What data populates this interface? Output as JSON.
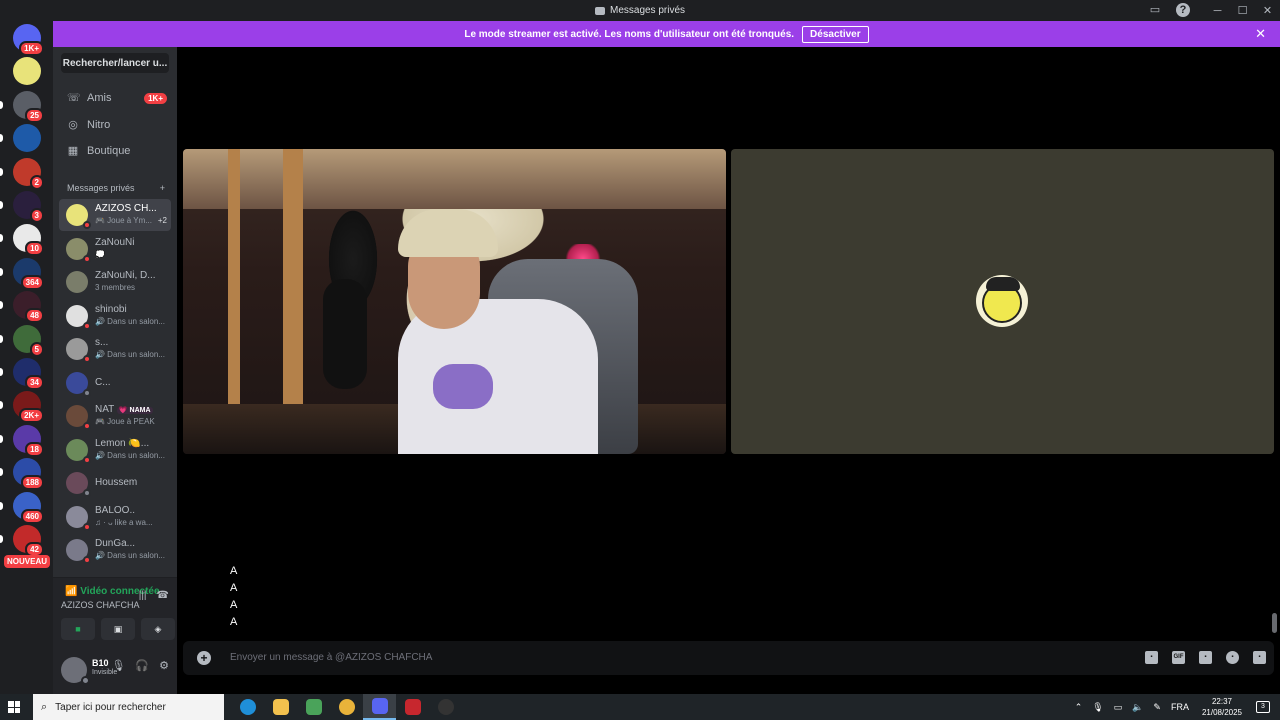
{
  "window": {
    "title": "Messages privés"
  },
  "banner": {
    "text": "Le mode streamer est activé. Les noms d'utilisateur ont été tronqués.",
    "button": "Désactiver"
  },
  "guilds": [
    {
      "badge": "1K+",
      "color": "#5865f2"
    },
    {
      "badge": "",
      "color": "#e8e37a"
    },
    {
      "badge": "25",
      "color": "#5a5e66"
    },
    {
      "badge": "",
      "color": "#1e5aa8"
    },
    {
      "badge": "2",
      "color": "#c03a2b"
    },
    {
      "badge": "3",
      "color": "#2a1f3d"
    },
    {
      "badge": "10",
      "color": "#e9e9e9"
    },
    {
      "badge": "364",
      "color": "#1b3a6b"
    },
    {
      "badge": "48",
      "color": "#3b1e2a"
    },
    {
      "badge": "5",
      "color": "#3f6b3a"
    },
    {
      "badge": "34",
      "color": "#1f2d6b"
    },
    {
      "badge": "2K+",
      "color": "#7a1a1a"
    },
    {
      "badge": "18",
      "color": "#5a3aa8"
    },
    {
      "badge": "188",
      "color": "#2c4ca8"
    },
    {
      "badge": "460",
      "color": "#3a62c8"
    },
    {
      "badge": "42",
      "color": "#c22a2a"
    }
  ],
  "nouveau": "NOUVEAU",
  "sidebar": {
    "search": "Rechercher/lancer u...",
    "nav": [
      {
        "label": "Amis",
        "badge": "1K+",
        "icon": "☏"
      },
      {
        "label": "Nitro",
        "badge": "",
        "icon": "◎"
      },
      {
        "label": "Boutique",
        "badge": "",
        "icon": "▦"
      }
    ],
    "dm_header": "Messages privés",
    "dm_add": "+",
    "dms": [
      {
        "name": "AZIZOS CH...",
        "sub": "🎮 Joue à Ym...",
        "extra": "+2",
        "color": "#e8e37a",
        "status": "#f23f43",
        "active": true
      },
      {
        "name": "ZaNouNi",
        "sub": "💭",
        "extra": "",
        "color": "#8a8d6a",
        "status": "#f23f43",
        "active": false
      },
      {
        "name": "ZaNouNi, D...",
        "sub": "3 membres",
        "extra": "",
        "color": "#7a7d6a",
        "status": "",
        "active": false
      },
      {
        "name": "shinobi",
        "sub": "🔊 Dans un salon...",
        "extra": "",
        "color": "#e0e0e0",
        "status": "#f23f43",
        "active": false
      },
      {
        "name": "s...",
        "sub": "🔊 Dans un salon...",
        "extra": "",
        "color": "#9a9a9a",
        "status": "#f23f43",
        "active": false
      },
      {
        "name": "C...",
        "sub": "",
        "extra": "",
        "color": "#3a4a9a",
        "status": "#80848e",
        "active": false
      },
      {
        "name": "NAT",
        "sub": "🎮 Joue à PEAK",
        "extra": "",
        "tag": "💗 NAMA",
        "color": "#6a4a3a",
        "status": "#f23f43",
        "active": false
      },
      {
        "name": "Lemon 🍋...",
        "sub": "🔊 Dans un salon...",
        "extra": "",
        "color": "#6b8a5a",
        "status": "#f23f43",
        "active": false
      },
      {
        "name": "Houssem",
        "sub": "",
        "extra": "",
        "color": "#6a4a5a",
        "status": "#80848e",
        "active": false
      },
      {
        "name": "BALOO..",
        "sub": "♫ · ᴗ like a wa...",
        "extra": "",
        "color": "#8a8a9a",
        "status": "#f23f43",
        "active": false
      },
      {
        "name": "DunGa...",
        "sub": "🔊 Dans un salon...",
        "extra": "",
        "color": "#7a7a8a",
        "status": "#f23f43",
        "active": false
      }
    ]
  },
  "voice": {
    "title": "Vidéo connectée",
    "channel": "AZIZOS CHAFCHA"
  },
  "user": {
    "name": "B10",
    "status": "Invisible"
  },
  "messages": [
    "A",
    "A",
    "A",
    "A"
  ],
  "composer": {
    "placeholder": "Envoyer un message à @AZIZOS CHAFCHA",
    "tools": [
      "gift-icon",
      "gif-icon",
      "sticker-icon",
      "emoji-icon",
      "activity-icon"
    ]
  },
  "taskbar": {
    "search": "Taper ici pour rechercher",
    "apps": [
      {
        "name": "edge",
        "color": "#1f8fd8"
      },
      {
        "name": "explorer",
        "color": "#f2c14e"
      },
      {
        "name": "store",
        "color": "#4aa35a"
      },
      {
        "name": "chrome",
        "color": "#e9b33a"
      },
      {
        "name": "discord",
        "color": "#5865f2"
      },
      {
        "name": "voice-meeter",
        "color": "#c7272e"
      },
      {
        "name": "obs",
        "color": "#333333"
      }
    ],
    "lang": "FRA",
    "time": "22:37",
    "date": "21/08/2025",
    "notif": "3"
  }
}
